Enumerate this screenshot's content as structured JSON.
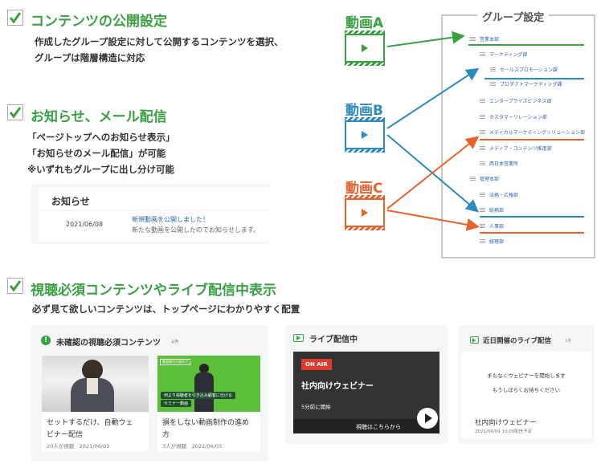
{
  "sections": {
    "s1": {
      "title": "コンテンツの公開設定",
      "desc1": "作成したグループ設定に対して公開するコンテンツを選択、",
      "desc2": "グループは階層構造に対応"
    },
    "s2": {
      "title": "お知らせ、メール配信",
      "desc1": "「ページトップへのお知らせ表示」",
      "desc2": "「お知らせのメール配信」が可能",
      "desc3": "※いずれもグループに出し分け可能"
    },
    "s3": {
      "title": "視聴必須コンテンツやライブ配信中表示",
      "desc1": "必ず見て欲しいコンテンツは、トップページにわかりやすく配置"
    }
  },
  "notice": {
    "heading": "お知らせ",
    "date": "2021/06/08",
    "link": "新規動画を公開しました！",
    "body": "新たな動画を公開したのでお知らせします。"
  },
  "videos": {
    "a": "動画A",
    "b": "動画B",
    "c": "動画C"
  },
  "colors": {
    "green": "#3aa142",
    "blue": "#2e8bc0",
    "orange": "#e8622c"
  },
  "group": {
    "title": "グループ設定",
    "items": [
      "営業本部",
      "マーケティング部",
      "セールスプロモーション課",
      "プロダクトマーケティング課",
      "エンタープライズビジネス部",
      "カスタマーリレーション部",
      "メディカルマーケティングソリューション部",
      "メディア・コンテンツ推進部",
      "西日本営業所",
      "管理本部",
      "法務・広報部",
      "総務部",
      "人事部",
      "経理部"
    ]
  },
  "required": {
    "heading": "未確認の視聴必須コンテンツ",
    "count": "4件",
    "cards": [
      {
        "title1": "セットするだけ、自動ウェ",
        "title2": "ビナー配信",
        "meta": "20人が視聴　2021/06/03"
      },
      {
        "title1": "損をしない動画制作の進め",
        "title2": "方",
        "meta": "3人が視聴　2021/06/03",
        "thumb_top": "動画制作の進め方",
        "thumb_caption": "何より視聴者を引き込み顧客に仕げる",
        "thumb_tag": "セミナー動画"
      }
    ]
  },
  "live": {
    "heading": "ライブ配信中",
    "badge": "ON AIR",
    "title": "社内向けウェビナー",
    "time": "5分前に開始",
    "cta": "視聴はこちらから"
  },
  "upcoming": {
    "heading": "近日開催のライブ配信",
    "count": "1件",
    "msg1": "まもなくウェビナーを開始します",
    "msg2": "もうしばらくお待ちください",
    "title": "社内向けウェビナー",
    "meta": "2021/06/09 10:00配信予定"
  }
}
